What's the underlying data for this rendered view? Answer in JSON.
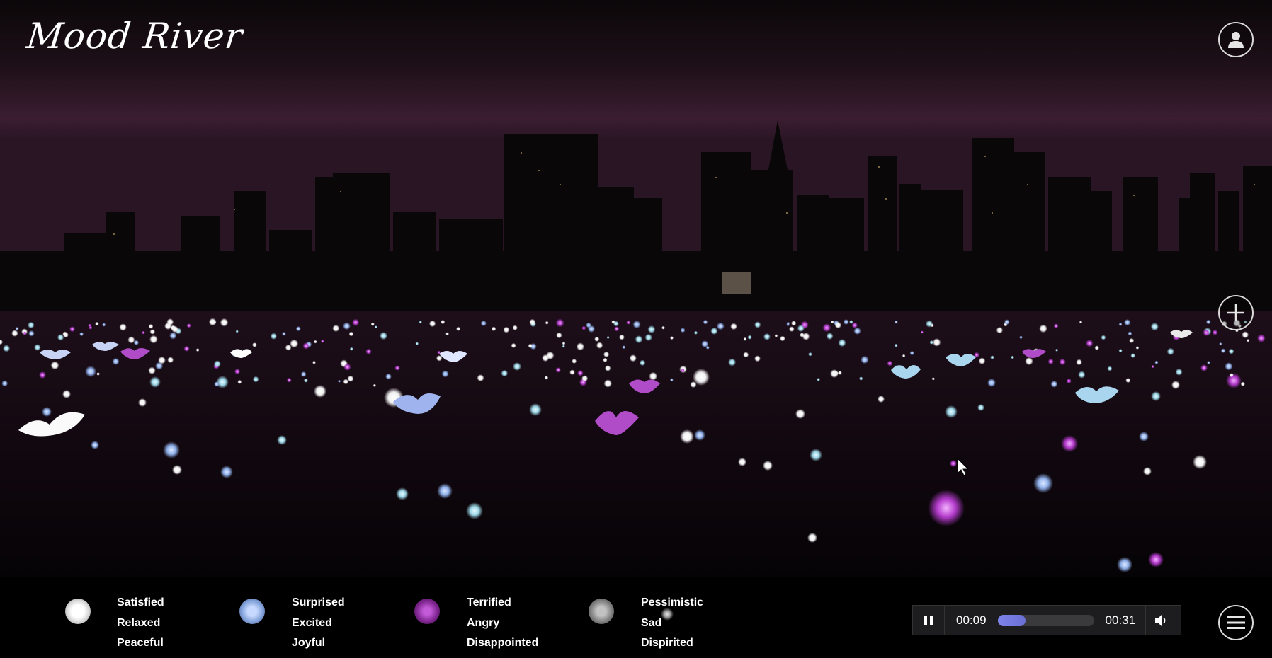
{
  "app": {
    "logo_text": "Mood River"
  },
  "header": {
    "profile_icon": "user-icon"
  },
  "controls": {
    "add_icon": "plus-icon",
    "menu_icon": "hamburger-menu-icon"
  },
  "legend": [
    {
      "color": "#ffffff",
      "words": [
        "Satisfied",
        "Relaxed",
        "Peaceful"
      ]
    },
    {
      "color": "#8fb0ea",
      "words": [
        "Surprised",
        "Excited",
        "Joyful"
      ]
    },
    {
      "color": "#a032b4",
      "words": [
        "Terrified",
        "Angry",
        "Disappointed"
      ]
    },
    {
      "color": "#9a9a9a",
      "words": [
        "Pessimistic",
        "Sad",
        "Dispirited"
      ]
    }
  ],
  "player": {
    "current_time": "00:09",
    "duration": "00:31",
    "progress": 0.29,
    "pause_icon": "pause-icon",
    "volume_icon": "volume-icon"
  }
}
